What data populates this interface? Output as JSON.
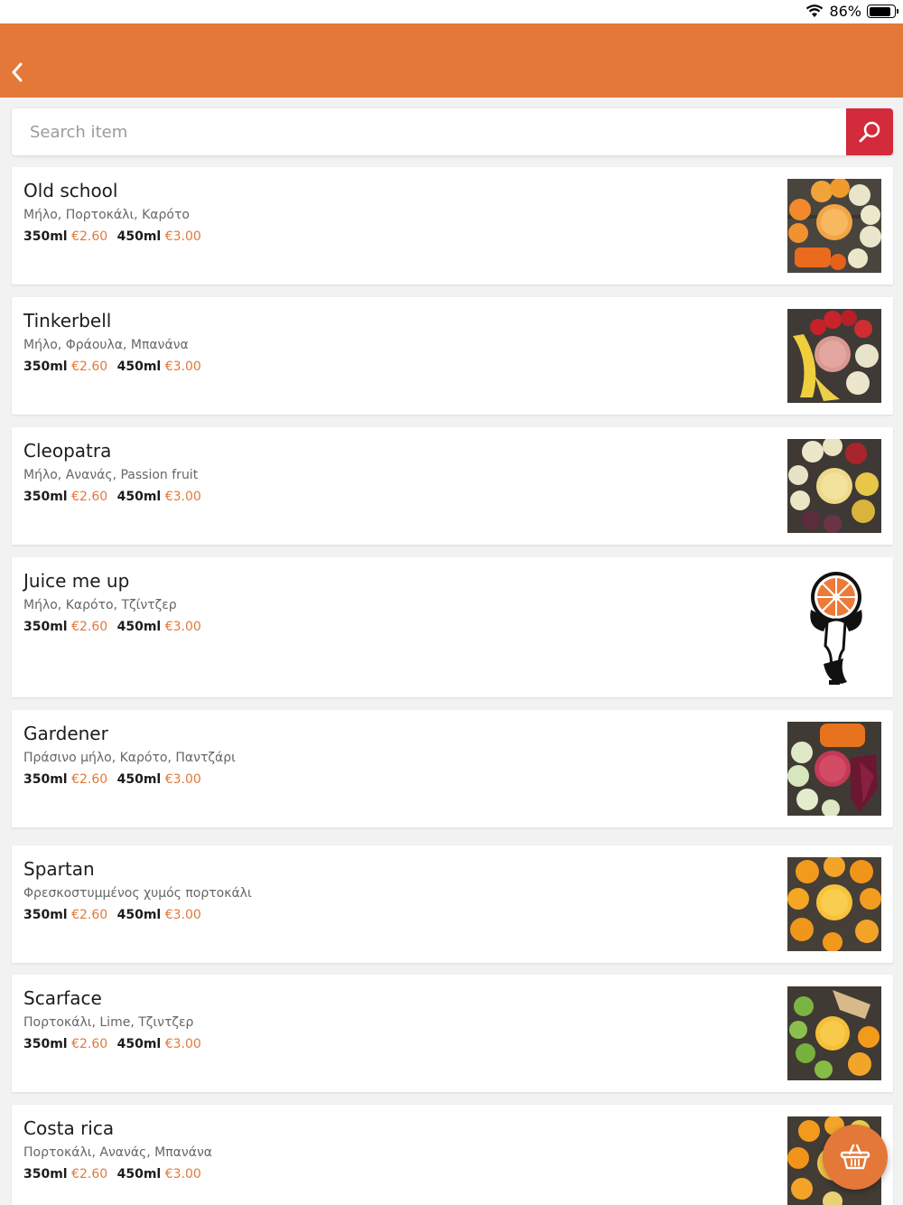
{
  "status": {
    "battery": "86%",
    "battery_level": 0.86
  },
  "search": {
    "placeholder": "Search item"
  },
  "colors": {
    "accent": "#e37839",
    "search_button": "#d32a3c",
    "price": "#e37839"
  },
  "items": [
    {
      "name": "Old school",
      "ingredients": "Μήλο, Πορτοκάλι, Καρότο",
      "size1": "350ml",
      "price1": "€2.60",
      "size2": "450ml",
      "price2": "€3.00"
    },
    {
      "name": "Tinkerbell",
      "ingredients": "Μήλο, Φράουλα, Μπανάνα",
      "size1": "350ml",
      "price1": "€2.60",
      "size2": "450ml",
      "price2": "€3.00"
    },
    {
      "name": "Cleopatra",
      "ingredients": "Μήλο, Ανανάς, Passion fruit",
      "size1": "350ml",
      "price1": "€2.60",
      "size2": "450ml",
      "price2": "€3.00"
    },
    {
      "name": "Juice me up",
      "ingredients": "Μήλο, Καρότο, Τζίντζερ",
      "size1": "350ml",
      "price1": "€2.60",
      "size2": "450ml",
      "price2": "€3.00"
    },
    {
      "name": "Gardener",
      "ingredients": "Πράσινο μήλο, Καρότο, Παντζάρι",
      "size1": "350ml",
      "price1": "€2.60",
      "size2": "450ml",
      "price2": "€3.00"
    },
    {
      "name": "Spartan",
      "ingredients": "Φρεσκοστυμμένος χυμός πορτοκάλι",
      "size1": "350ml",
      "price1": "€2.60",
      "size2": "450ml",
      "price2": "€3.00"
    },
    {
      "name": "Scarface",
      "ingredients": "Πορτοκάλι, Lime, Τζιντζερ",
      "size1": "350ml",
      "price1": "€2.60",
      "size2": "450ml",
      "price2": "€3.00"
    },
    {
      "name": "Costa rica",
      "ingredients": "Πορτοκάλι, Ανανάς, Μπανάνα",
      "size1": "350ml",
      "price1": "€2.60",
      "size2": "450ml",
      "price2": "€3.00"
    }
  ]
}
